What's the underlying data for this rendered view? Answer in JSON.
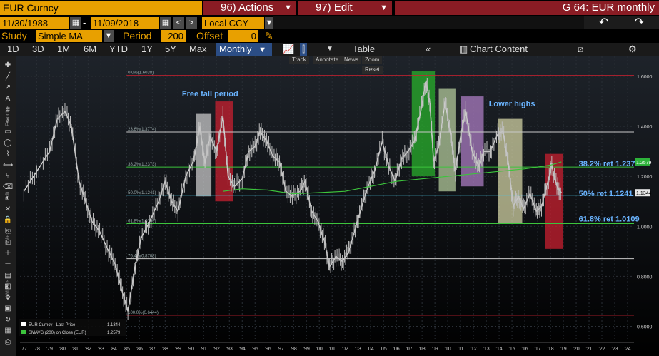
{
  "header": {
    "ticker": "EUR Curncy",
    "actions_label": "96) Actions",
    "edit_label": "97) Edit",
    "title": "G 64: EUR monthly"
  },
  "dates": {
    "start": "11/30/1988",
    "separator": "-",
    "end": "11/09/2018",
    "currency": "Local CCY"
  },
  "study": {
    "label": "Study",
    "value": "Simple MA",
    "period_label": "Period",
    "period_value": "200",
    "offset_label": "Offset",
    "offset_value": "0"
  },
  "toolbar": {
    "ranges": [
      "1D",
      "3D",
      "1M",
      "6M",
      "YTD",
      "1Y",
      "5Y",
      "Max"
    ],
    "frequency": "Monthly",
    "table_label": "Table",
    "chart_content_label": "Chart Content"
  },
  "mini_toolbar": {
    "track": "Track",
    "annotate": "Annotate",
    "news": "News",
    "zoom": "Zoom",
    "reset": "Reset"
  },
  "icons": {
    "back": "back-arrow-icon",
    "forward": "forward-arrow-icon",
    "pen": "pencil-icon",
    "settings": "gear-icon"
  },
  "colors": {
    "amber": "#e8a000",
    "bloomberg_red": "#8a1c24",
    "price_line": "#d8d8d8",
    "ma_line": "#3cc43c",
    "fib_cyan": "#46c8e8",
    "fib_green": "#3cc43c",
    "fib_red": "#d02030"
  },
  "chart_data": {
    "type": "line",
    "x_ticks": [
      "'77",
      "'78",
      "'79",
      "'80",
      "'81",
      "'82",
      "'83",
      "'84",
      "'85",
      "'86",
      "'87",
      "'88",
      "'89",
      "'90",
      "'91",
      "'92",
      "'93",
      "'94",
      "'95",
      "'96",
      "'97",
      "'98",
      "'99",
      "'00",
      "'01",
      "'02",
      "'03",
      "'04",
      "'05",
      "'06",
      "'07",
      "'08",
      "'09",
      "'10",
      "'11",
      "'12",
      "'13",
      "'14",
      "'15",
      "'16",
      "'17",
      "'18",
      "'19",
      "'20",
      "'21",
      "'22",
      "'23",
      "'24"
    ],
    "y_ticks": [
      "1.6000",
      "1.4000",
      "1.2000",
      "1.0000",
      "0.8000",
      "0.6000"
    ],
    "ylim": [
      0.55,
      1.68
    ],
    "xlim": [
      1976.7,
      2024.5
    ],
    "price_series": [
      [
        1977.0,
        1.14
      ],
      [
        1978.0,
        1.22
      ],
      [
        1979.0,
        1.3
      ],
      [
        1979.6,
        1.43
      ],
      [
        1980.2,
        1.46
      ],
      [
        1980.7,
        1.4
      ],
      [
        1981.3,
        1.18
      ],
      [
        1981.8,
        1.1
      ],
      [
        1982.3,
        1.02
      ],
      [
        1982.9,
        0.98
      ],
      [
        1983.6,
        0.9
      ],
      [
        1984.1,
        0.85
      ],
      [
        1984.6,
        0.75
      ],
      [
        1985.1,
        0.66
      ],
      [
        1985.6,
        0.82
      ],
      [
        1986.1,
        0.95
      ],
      [
        1986.8,
        1.02
      ],
      [
        1987.5,
        1.1
      ],
      [
        1988.0,
        1.18
      ],
      [
        1988.5,
        1.1
      ],
      [
        1989.0,
        1.06
      ],
      [
        1989.6,
        1.2
      ],
      [
        1990.2,
        1.26
      ],
      [
        1990.7,
        1.4
      ],
      [
        1991.1,
        1.25
      ],
      [
        1991.5,
        1.36
      ],
      [
        1992.0,
        1.3
      ],
      [
        1992.5,
        1.44
      ],
      [
        1992.9,
        1.2
      ],
      [
        1993.4,
        1.16
      ],
      [
        1994.0,
        1.19
      ],
      [
        1994.5,
        1.3
      ],
      [
        1995.0,
        1.32
      ],
      [
        1995.4,
        1.38
      ],
      [
        1995.9,
        1.34
      ],
      [
        1996.4,
        1.28
      ],
      [
        1996.9,
        1.26
      ],
      [
        1997.4,
        1.14
      ],
      [
        1997.9,
        1.12
      ],
      [
        1998.5,
        1.14
      ],
      [
        1998.9,
        1.18
      ],
      [
        1999.4,
        1.06
      ],
      [
        1999.9,
        1.02
      ],
      [
        2000.4,
        0.94
      ],
      [
        2000.8,
        0.84
      ],
      [
        2001.3,
        0.88
      ],
      [
        2001.8,
        0.86
      ],
      [
        2002.3,
        0.9
      ],
      [
        2002.8,
        0.99
      ],
      [
        2003.3,
        1.08
      ],
      [
        2003.8,
        1.16
      ],
      [
        2004.3,
        1.22
      ],
      [
        2004.9,
        1.34
      ],
      [
        2005.4,
        1.24
      ],
      [
        2005.9,
        1.18
      ],
      [
        2006.4,
        1.27
      ],
      [
        2006.9,
        1.3
      ],
      [
        2007.4,
        1.34
      ],
      [
        2007.9,
        1.46
      ],
      [
        2008.3,
        1.58
      ],
      [
        2008.6,
        1.5
      ],
      [
        2008.9,
        1.26
      ],
      [
        2009.3,
        1.32
      ],
      [
        2009.8,
        1.5
      ],
      [
        2010.3,
        1.34
      ],
      [
        2010.6,
        1.22
      ],
      [
        2011.0,
        1.36
      ],
      [
        2011.4,
        1.46
      ],
      [
        2011.9,
        1.3
      ],
      [
        2012.4,
        1.24
      ],
      [
        2012.8,
        1.3
      ],
      [
        2013.3,
        1.3
      ],
      [
        2013.9,
        1.37
      ],
      [
        2014.3,
        1.38
      ],
      [
        2014.7,
        1.26
      ],
      [
        2015.1,
        1.08
      ],
      [
        2015.5,
        1.12
      ],
      [
        2015.9,
        1.07
      ],
      [
        2016.4,
        1.13
      ],
      [
        2016.9,
        1.06
      ],
      [
        2017.3,
        1.08
      ],
      [
        2017.8,
        1.18
      ],
      [
        2018.1,
        1.24
      ],
      [
        2018.5,
        1.16
      ],
      [
        2018.85,
        1.1344
      ]
    ],
    "ma_series": [
      [
        1992.5,
        1.14
      ],
      [
        1994.0,
        1.15
      ],
      [
        1996.0,
        1.145
      ],
      [
        1998.0,
        1.13
      ],
      [
        2000.0,
        1.135
      ],
      [
        2002.0,
        1.14
      ],
      [
        2004.0,
        1.16
      ],
      [
        2006.0,
        1.18
      ],
      [
        2008.0,
        1.19
      ],
      [
        2010.0,
        1.2
      ],
      [
        2012.0,
        1.21
      ],
      [
        2014.0,
        1.22
      ],
      [
        2016.0,
        1.23
      ],
      [
        2018.0,
        1.245
      ],
      [
        2018.85,
        1.2579
      ]
    ],
    "fib_levels": [
      {
        "label": "0.0%(1.6038)",
        "value": 1.6038,
        "color": "#d02030"
      },
      {
        "label": "23.6%(1.3774)",
        "value": 1.3774,
        "color": "#c8c8c8"
      },
      {
        "label": "38.2%(1.2373)",
        "value": 1.2373,
        "color": "#3cc43c"
      },
      {
        "label": "50.0%(1.1241)",
        "value": 1.1241,
        "color": "#46c8e8"
      },
      {
        "label": "61.8%(1.0109)",
        "value": 1.0109,
        "color": "#3cc43c"
      },
      {
        "label": "76.4%(0.8708)",
        "value": 0.8708,
        "color": "#c8c8c8"
      },
      {
        "label": "100.0%(0.6444)",
        "value": 0.6444,
        "color": "#d02030"
      }
    ],
    "highlight_boxes": [
      {
        "x0": 1990.4,
        "x1": 1991.6,
        "y0": 1.12,
        "y1": 1.45,
        "color": "#cfcfcf"
      },
      {
        "x0": 1991.9,
        "x1": 1993.3,
        "y0": 1.1,
        "y1": 1.5,
        "color": "#d02030"
      },
      {
        "x0": 2007.2,
        "x1": 2009.0,
        "y0": 1.2,
        "y1": 1.62,
        "color": "#29b62c"
      },
      {
        "x0": 2009.3,
        "x1": 2010.6,
        "y0": 1.14,
        "y1": 1.55,
        "color": "#b8d0a0"
      },
      {
        "x0": 2011.0,
        "x1": 2012.8,
        "y0": 1.16,
        "y1": 1.52,
        "color": "#b080c8"
      },
      {
        "x0": 2013.9,
        "x1": 2015.8,
        "y0": 1.01,
        "y1": 1.43,
        "color": "#d8d8a8"
      },
      {
        "x0": 2017.6,
        "x1": 2019.0,
        "y0": 0.91,
        "y1": 1.29,
        "color": "#d02030"
      }
    ],
    "annotations": [
      {
        "text": "Free fall period",
        "x": 1991.5,
        "y": 1.52,
        "color": "#6ab4ff"
      },
      {
        "text": "Lower highs",
        "x": 2015.0,
        "y": 1.48,
        "color": "#6ab4ff"
      },
      {
        "text": "38.2% ret 1.2373",
        "x": 2020.2,
        "y": 1.24,
        "color": "#6ab4ff"
      },
      {
        "text": "50% ret 1.1241",
        "x": 2020.2,
        "y": 1.12,
        "color": "#6ab4ff"
      },
      {
        "text": "61.8% ret 1.0109",
        "x": 2020.2,
        "y": 1.02,
        "color": "#6ab4ff"
      }
    ],
    "last_price_badge": "1.1344",
    "ma_badge": "1.2579",
    "legend": [
      {
        "label": "EUR Curncy - Last Price",
        "value": "1.1344",
        "color": "#ffffff"
      },
      {
        "label": "SMAVG (200) on Close (EUR)",
        "value": "1.2579",
        "color": "#3cc43c"
      }
    ]
  },
  "left_tools": [
    "crosshair",
    "line",
    "arrow",
    "text",
    "fib",
    "channel",
    "rect",
    "ellipse",
    "polyline",
    "measure",
    "pitchfork",
    "eraser",
    "hide",
    "delete",
    "lock",
    "copy",
    "paste",
    "zoom-in",
    "zoom-out",
    "style",
    "palette",
    "move",
    "save",
    "refresh",
    "grid",
    "print"
  ],
  "left_tool_labels": [
    "Favorites",
    "Edit",
    "Style",
    "Modes"
  ]
}
